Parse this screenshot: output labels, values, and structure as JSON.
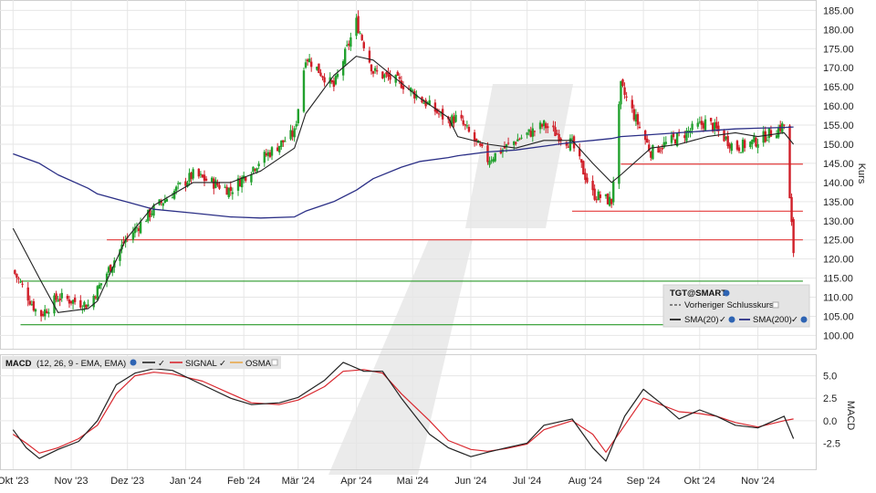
{
  "colors": {
    "up": "#22a12e",
    "down": "#d01e28",
    "sma20": "#222222",
    "sma200": "#2b2f86",
    "hline_red": "#e43b3b",
    "hline_green": "#2a9a2a",
    "macd": "#222222",
    "signal": "#d9282f",
    "osma": "#e8a84b",
    "grid": "#e6e6e6",
    "legend_bg": "#e4e4e4",
    "watermark": "#ebebeb"
  },
  "price_panel": {
    "ticker_legend": "TGT@SMART",
    "prev_close_label": "Vorheriger Schlusskurs",
    "sma20_label": "SMA(20)",
    "sma200_label": "SMA(200)",
    "ylabel": "Kurs",
    "yticks": [
      "185.00",
      "180.00",
      "175.00",
      "170.00",
      "165.00",
      "160.00",
      "155.00",
      "150.00",
      "145.00",
      "140.00",
      "135.00",
      "130.00",
      "125.00",
      "120.00",
      "115.00",
      "110.00",
      "105.00",
      "100.00"
    ]
  },
  "macd_panel": {
    "legend_macd": "MACD",
    "legend_params": "(12, 26, 9 - EMA, EMA)",
    "legend_signal": "SIGNAL",
    "legend_osma": "OSMA",
    "ylabel": "MACD",
    "yticks": [
      "5.0",
      "2.5",
      "0.0",
      "-2.5"
    ]
  },
  "x_axis": {
    "labels": [
      "Okt '23",
      "Nov '23",
      "Dez '23",
      "Jan '24",
      "Feb '24",
      "Mär '24",
      "Apr '24",
      "Mai '24",
      "Jun '24",
      "Jul '24",
      "Aug '24",
      "Sep '24",
      "Okt '24",
      "Nov '24"
    ]
  },
  "chart_data": [
    {
      "type": "candlestick",
      "ylim": [
        97,
        187
      ],
      "x": [
        "2023-10-01",
        "2023-10-15",
        "2023-10-25",
        "2023-11-10",
        "2023-11-15",
        "2023-11-30",
        "2023-12-15",
        "2024-01-05",
        "2024-01-25",
        "2024-02-10",
        "2024-02-28",
        "2024-03-05",
        "2024-03-20",
        "2024-04-01",
        "2024-04-10",
        "2024-04-25",
        "2024-05-05",
        "2024-05-20",
        "2024-05-25",
        "2024-06-10",
        "2024-06-25",
        "2024-07-10",
        "2024-07-25",
        "2024-08-05",
        "2024-08-15",
        "2024-08-20",
        "2024-09-05",
        "2024-09-20",
        "2024-10-05",
        "2024-10-20",
        "2024-11-01",
        "2024-11-15",
        "2024-11-20"
      ],
      "close": [
        117,
        105,
        110,
        108,
        112,
        125,
        133,
        142,
        138,
        146,
        153,
        173,
        165,
        182,
        169,
        166,
        162,
        156,
        157,
        146,
        151,
        155,
        150,
        137,
        135,
        165,
        148,
        152,
        156,
        149,
        151,
        155,
        122
      ],
      "sma20": [
        128,
        115,
        106,
        107,
        109,
        125,
        134,
        140,
        140,
        143,
        149,
        158,
        168,
        173,
        172,
        166,
        162,
        157,
        152,
        150,
        149,
        151,
        151,
        145,
        140,
        142,
        149,
        150,
        152,
        153,
        152,
        153,
        150
      ],
      "sma200": [
        147.5,
        145,
        142,
        138.5,
        137,
        135,
        133,
        132,
        131,
        130.7,
        131,
        132.5,
        135,
        138,
        141,
        144,
        145.5,
        146.5,
        147,
        148,
        148.5,
        149.5,
        150.5,
        151,
        151.5,
        152,
        152.5,
        153,
        153.5,
        154,
        154.2,
        154.4,
        154.5
      ],
      "horizontal_lines": [
        {
          "kind": "resistance",
          "value": 144.8,
          "from": "2024-08-20",
          "to": "2024-11-25"
        },
        {
          "kind": "resistance",
          "value": 132.5,
          "from": "2024-07-25",
          "to": "2024-11-25"
        },
        {
          "kind": "resistance",
          "value": 125,
          "from": "2023-11-20",
          "to": "2024-11-25"
        },
        {
          "kind": "support",
          "value": 114.2,
          "from": "2023-10-05",
          "to": "2024-11-25"
        },
        {
          "kind": "support",
          "value": 102.8,
          "from": "2023-10-05",
          "to": "2024-11-25"
        }
      ]
    },
    {
      "type": "line",
      "ylim": [
        -5.2,
        7.2
      ],
      "series": [
        {
          "name": "MACD",
          "values": [
            -1.0,
            -3.0,
            -4.2,
            -3.2,
            -2.3,
            0.0,
            4.0,
            5.3,
            5.8,
            5.6,
            4.0,
            2.5,
            1.8,
            2.0,
            2.6,
            4.5,
            6.5,
            5.5,
            5.5,
            2.5,
            -1.5,
            -3.0,
            -4.0,
            -3.5,
            -3.0,
            -2.5,
            -0.5,
            0.2,
            -3.0,
            -4.5,
            0.5,
            3.5,
            2.0,
            0.2,
            1.2,
            0.5,
            -0.5,
            -0.8,
            0.5,
            -2.0
          ]
        },
        {
          "name": "SIGNAL",
          "values": [
            -1.5,
            -2.5,
            -3.6,
            -3.0,
            -2.0,
            -0.5,
            3.0,
            5.0,
            5.4,
            5.2,
            4.4,
            3.0,
            2.0,
            1.8,
            2.3,
            3.8,
            5.5,
            5.7,
            5.3,
            3.0,
            0.0,
            -2.2,
            -3.2,
            -3.4,
            -3.1,
            -2.6,
            -1.0,
            0.0,
            -1.5,
            -3.5,
            -0.5,
            2.5,
            1.8,
            1.0,
            0.8,
            0.5,
            -0.2,
            -0.7,
            0.0,
            0.2
          ]
        }
      ],
      "x": [
        "2023-10-01",
        "2023-10-08",
        "2023-10-15",
        "2023-10-25",
        "2023-11-05",
        "2023-11-15",
        "2023-11-25",
        "2023-12-05",
        "2023-12-15",
        "2023-12-25",
        "2024-01-10",
        "2024-01-25",
        "2024-02-05",
        "2024-02-20",
        "2024-03-01",
        "2024-03-15",
        "2024-03-25",
        "2024-04-05",
        "2024-04-15",
        "2024-04-25",
        "2024-05-10",
        "2024-05-20",
        "2024-06-01",
        "2024-06-10",
        "2024-06-20",
        "2024-07-01",
        "2024-07-10",
        "2024-07-25",
        "2024-08-05",
        "2024-08-12",
        "2024-08-22",
        "2024-09-01",
        "2024-09-10",
        "2024-09-20",
        "2024-10-01",
        "2024-10-10",
        "2024-10-20",
        "2024-11-01",
        "2024-11-15",
        "2024-11-20"
      ]
    }
  ]
}
